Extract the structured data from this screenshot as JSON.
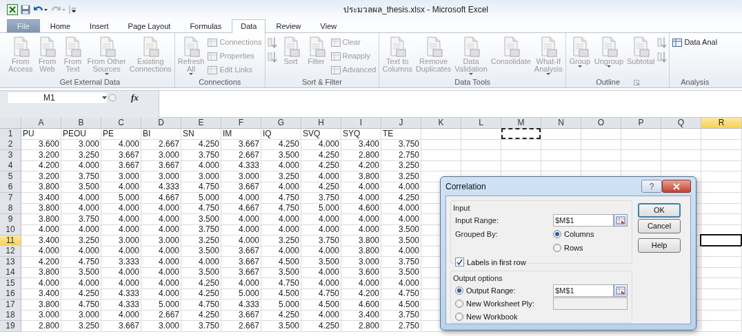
{
  "window": {
    "title": "ประมวลผล_thesis.xlsx  -  Microsoft Excel",
    "quick_access": [
      {
        "kind": "logo"
      },
      {
        "kind": "save",
        "disabled": false
      },
      {
        "kind": "undo",
        "disabled": false
      },
      {
        "kind": "redo",
        "disabled": true
      },
      {
        "kind": "customize"
      }
    ]
  },
  "tabs": [
    {
      "label": "File",
      "kind": "file",
      "selected": false
    },
    {
      "label": "Home",
      "kind": "tab",
      "selected": false
    },
    {
      "label": "Insert",
      "kind": "tab",
      "selected": false
    },
    {
      "label": "Page Layout",
      "kind": "tab",
      "selected": false
    },
    {
      "label": "Formulas",
      "kind": "tab",
      "selected": false
    },
    {
      "label": "Data",
      "kind": "tab",
      "selected": true
    },
    {
      "label": "Review",
      "kind": "tab",
      "selected": false
    },
    {
      "label": "View",
      "kind": "tab",
      "selected": false
    }
  ],
  "ribbon": [
    {
      "label": "Get External Data",
      "launcher": false,
      "items": [
        {
          "kind": "large",
          "label": "From\nAccess",
          "disabled": true,
          "dropdown": false
        },
        {
          "kind": "large",
          "label": "From\nWeb",
          "disabled": true,
          "dropdown": false
        },
        {
          "kind": "large",
          "label": "From\nText",
          "disabled": true,
          "dropdown": false
        },
        {
          "kind": "large",
          "label": "From Other\nSources",
          "disabled": true,
          "dropdown": true
        },
        {
          "kind": "large",
          "label": "Existing\nConnections",
          "disabled": true,
          "dropdown": false
        }
      ]
    },
    {
      "label": "Connections",
      "launcher": false,
      "items": [
        {
          "kind": "large",
          "label": "Refresh\nAll",
          "disabled": true,
          "dropdown": true
        },
        {
          "kind": "stack",
          "items": [
            {
              "kind": "small",
              "label": "Connections",
              "disabled": true
            },
            {
              "kind": "small",
              "label": "Properties",
              "disabled": true
            },
            {
              "kind": "small",
              "label": "Edit Links",
              "disabled": true
            }
          ]
        }
      ]
    },
    {
      "label": "Sort & Filter",
      "launcher": false,
      "items": [
        {
          "kind": "stack",
          "items": [
            {
              "kind": "icon",
              "disabled": true
            },
            {
              "kind": "icon",
              "disabled": true
            }
          ]
        },
        {
          "kind": "large",
          "label": "Sort",
          "disabled": true,
          "dropdown": false
        },
        {
          "kind": "large",
          "label": "Filter",
          "disabled": true,
          "dropdown": false
        },
        {
          "kind": "stack",
          "items": [
            {
              "kind": "small",
              "label": "Clear",
              "disabled": true
            },
            {
              "kind": "small",
              "label": "Reapply",
              "disabled": true
            },
            {
              "kind": "small",
              "label": "Advanced",
              "disabled": true
            }
          ]
        }
      ]
    },
    {
      "label": "Data Tools",
      "launcher": false,
      "items": [
        {
          "kind": "large",
          "label": "Text to\nColumns",
          "disabled": true,
          "dropdown": false
        },
        {
          "kind": "large",
          "label": "Remove\nDuplicates",
          "disabled": true,
          "dropdown": false
        },
        {
          "kind": "large",
          "label": "Data\nValidation",
          "disabled": true,
          "dropdown": true
        },
        {
          "kind": "large",
          "label": "Consolidate",
          "disabled": true,
          "dropdown": false
        },
        {
          "kind": "large",
          "label": "What-If\nAnalysis",
          "disabled": true,
          "dropdown": true
        }
      ]
    },
    {
      "label": "Outline",
      "launcher": true,
      "items": [
        {
          "kind": "large",
          "label": "Group",
          "disabled": true,
          "dropdown": true
        },
        {
          "kind": "large",
          "label": "Ungroup",
          "disabled": true,
          "dropdown": true
        },
        {
          "kind": "large",
          "label": "Subtotal",
          "disabled": true,
          "dropdown": false
        },
        {
          "kind": "stack",
          "items": [
            {
              "kind": "icon",
              "disabled": true
            },
            {
              "kind": "icon",
              "disabled": true
            }
          ]
        }
      ]
    },
    {
      "label": "Analysis",
      "launcher": false,
      "items": [
        {
          "kind": "stack",
          "items": [
            {
              "kind": "small",
              "label": "Data Anal",
              "disabled": false
            }
          ]
        }
      ]
    }
  ],
  "formula_bar": {
    "name_box": "M1",
    "function_label": "fx"
  },
  "columns": [
    {
      "letter": "A",
      "selected": false,
      "marquee": false
    },
    {
      "letter": "B",
      "selected": false,
      "marquee": false
    },
    {
      "letter": "C",
      "selected": false,
      "marquee": false
    },
    {
      "letter": "D",
      "selected": false,
      "marquee": false
    },
    {
      "letter": "E",
      "selected": false,
      "marquee": false
    },
    {
      "letter": "F",
      "selected": false,
      "marquee": false
    },
    {
      "letter": "G",
      "selected": false,
      "marquee": false
    },
    {
      "letter": "H",
      "selected": false,
      "marquee": false
    },
    {
      "letter": "I",
      "selected": false,
      "marquee": false
    },
    {
      "letter": "J",
      "selected": false,
      "marquee": false
    },
    {
      "letter": "K",
      "selected": false,
      "marquee": false
    },
    {
      "letter": "L",
      "selected": false,
      "marquee": false
    },
    {
      "letter": "M",
      "selected": false,
      "marquee": true
    },
    {
      "letter": "N",
      "selected": false,
      "marquee": false
    },
    {
      "letter": "O",
      "selected": false,
      "marquee": false
    },
    {
      "letter": "P",
      "selected": false,
      "marquee": false
    },
    {
      "letter": "Q",
      "selected": false,
      "marquee": false
    },
    {
      "letter": "R",
      "selected": true,
      "marquee": false
    }
  ],
  "rows": [
    {
      "number": "1",
      "kind": "header",
      "selected": false,
      "cells": [
        "PU",
        "PEOU",
        "PE",
        "BI",
        "SN",
        "IM",
        "IQ",
        "SVQ",
        "SYQ",
        "TE"
      ]
    },
    {
      "number": "2",
      "kind": "data",
      "selected": false,
      "cells": [
        "3.600",
        "3.000",
        "4.000",
        "2.667",
        "4.250",
        "3.667",
        "4.250",
        "4.000",
        "3.400",
        "3.750"
      ]
    },
    {
      "number": "3",
      "kind": "data",
      "selected": false,
      "cells": [
        "3.200",
        "3.250",
        "3.667",
        "3.000",
        "3.750",
        "2.667",
        "3.500",
        "4.250",
        "2.800",
        "2.750"
      ]
    },
    {
      "number": "4",
      "kind": "data",
      "selected": false,
      "cells": [
        "4.200",
        "4.000",
        "3.667",
        "3.667",
        "4.000",
        "4.333",
        "4.000",
        "4.250",
        "4.200",
        "3.250"
      ]
    },
    {
      "number": "5",
      "kind": "data",
      "selected": false,
      "cells": [
        "3.200",
        "3.750",
        "3.000",
        "3.000",
        "3.000",
        "3.000",
        "3.250",
        "4.000",
        "3.800",
        "3.250"
      ]
    },
    {
      "number": "6",
      "kind": "data",
      "selected": false,
      "cells": [
        "3.800",
        "3.500",
        "4.000",
        "4.333",
        "4.750",
        "3.667",
        "4.000",
        "4.250",
        "4.000",
        "4.000"
      ]
    },
    {
      "number": "7",
      "kind": "data",
      "selected": false,
      "cells": [
        "3.400",
        "4.000",
        "5.000",
        "4.667",
        "5.000",
        "4.000",
        "4.750",
        "3.750",
        "4.000",
        "4.250"
      ]
    },
    {
      "number": "8",
      "kind": "data",
      "selected": false,
      "cells": [
        "3.800",
        "4.000",
        "4.000",
        "4.000",
        "4.750",
        "4.667",
        "4.750",
        "5.000",
        "4.600",
        "4.000"
      ]
    },
    {
      "number": "9",
      "kind": "data",
      "selected": false,
      "cells": [
        "3.800",
        "3.750",
        "4.000",
        "4.000",
        "3.500",
        "4.000",
        "4.000",
        "4.000",
        "4.000",
        "4.000"
      ]
    },
    {
      "number": "10",
      "kind": "data",
      "selected": false,
      "cells": [
        "4.000",
        "4.000",
        "4.000",
        "4.000",
        "3.750",
        "4.000",
        "4.000",
        "4.000",
        "4.000",
        "3.500"
      ]
    },
    {
      "number": "11",
      "kind": "data",
      "selected": true,
      "cells": [
        "3.400",
        "3.250",
        "3.000",
        "3.000",
        "3.250",
        "4.000",
        "3.250",
        "3.750",
        "3.800",
        "3.500"
      ]
    },
    {
      "number": "12",
      "kind": "data",
      "selected": false,
      "cells": [
        "4.000",
        "4.000",
        "4.000",
        "4.000",
        "3.500",
        "3.667",
        "4.000",
        "4.000",
        "3.800",
        "4.000"
      ]
    },
    {
      "number": "13",
      "kind": "data",
      "selected": false,
      "cells": [
        "4.200",
        "4.750",
        "3.333",
        "4.000",
        "4.000",
        "3.667",
        "4.500",
        "3.500",
        "3.000",
        "3.750"
      ]
    },
    {
      "number": "14",
      "kind": "data",
      "selected": false,
      "cells": [
        "3.800",
        "3.500",
        "4.000",
        "4.000",
        "3.500",
        "3.667",
        "3.500",
        "4.000",
        "3.600",
        "3.500"
      ]
    },
    {
      "number": "15",
      "kind": "data",
      "selected": false,
      "cells": [
        "4.000",
        "4.000",
        "4.000",
        "4.000",
        "4.250",
        "4.000",
        "4.750",
        "4.000",
        "4.000",
        "4.000"
      ]
    },
    {
      "number": "16",
      "kind": "data",
      "selected": false,
      "cells": [
        "3.400",
        "4.250",
        "4.333",
        "4.000",
        "4.250",
        "5.000",
        "4.500",
        "4.750",
        "4.200",
        "4.750"
      ]
    },
    {
      "number": "17",
      "kind": "data",
      "selected": false,
      "cells": [
        "3.800",
        "4.750",
        "4.333",
        "5.000",
        "4.750",
        "4.333",
        "5.000",
        "4.500",
        "4.600",
        "4.500"
      ]
    },
    {
      "number": "18",
      "kind": "data",
      "selected": false,
      "cells": [
        "3.000",
        "3.000",
        "4.000",
        "2.667",
        "4.250",
        "3.667",
        "4.250",
        "4.000",
        "3.400",
        "3.750"
      ]
    },
    {
      "number": "19",
      "kind": "data",
      "selected": false,
      "cells": [
        "2.800",
        "3.250",
        "3.667",
        "3.000",
        "3.750",
        "2.667",
        "3.500",
        "4.250",
        "2.800",
        "2.750"
      ]
    }
  ],
  "dialog": {
    "title": "Correlation",
    "help_button": "?",
    "input_group": {
      "title": "Input",
      "input_range": {
        "label": "Input Range:",
        "value": "$M$1"
      },
      "grouped_by": {
        "label": "Grouped By:",
        "options": [
          {
            "label": "Columns",
            "selected": true
          },
          {
            "label": "Rows",
            "selected": false
          }
        ]
      },
      "labels_checkbox": {
        "label": "Labels in first row",
        "checked": true
      }
    },
    "output_group": {
      "title": "Output options",
      "options": [
        {
          "label": "Output Range:",
          "selected": true,
          "field": {
            "value": "$M$1",
            "disabled": false
          }
        },
        {
          "label": "New Worksheet Ply:",
          "selected": false,
          "field": {
            "disabled": true
          }
        },
        {
          "label": "New Workbook",
          "selected": false
        }
      ]
    },
    "buttons": [
      {
        "label": "OK",
        "default": true
      },
      {
        "label": "Cancel",
        "default": false
      },
      {
        "label": "Help",
        "default": false
      }
    ]
  }
}
